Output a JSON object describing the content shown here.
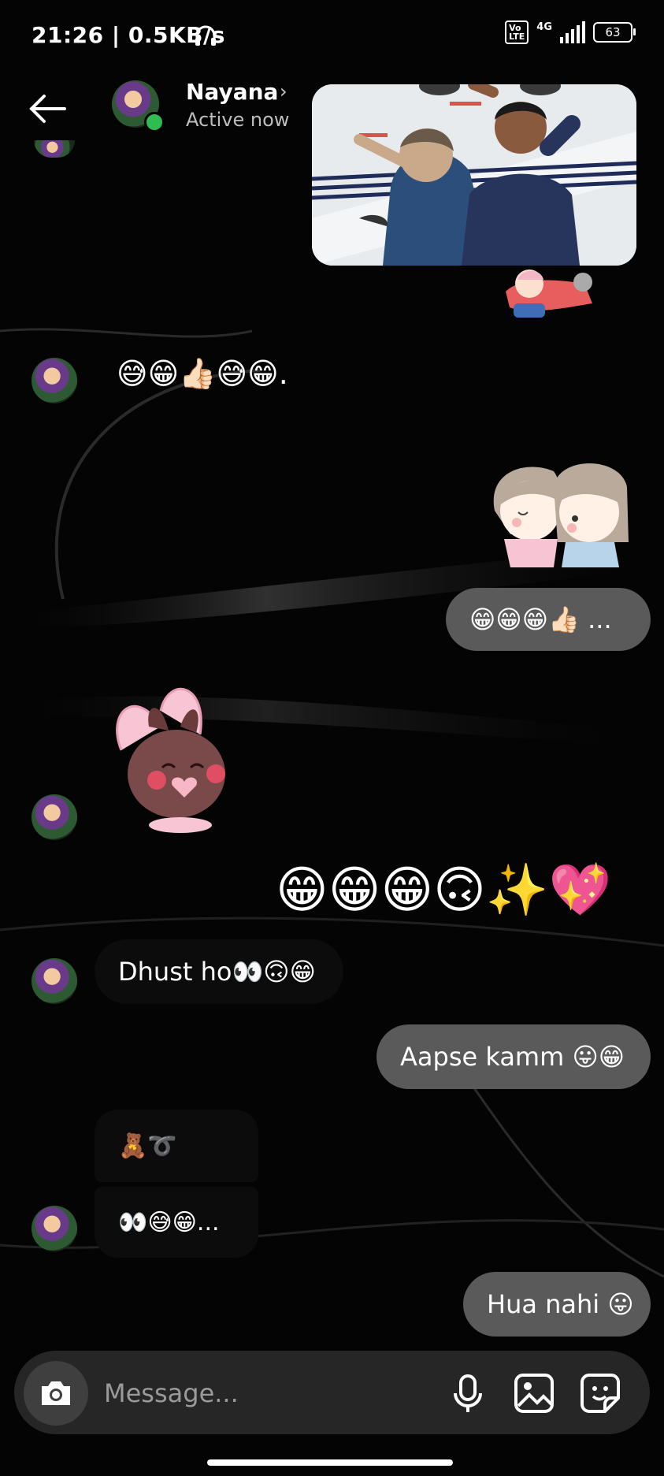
{
  "status_bar": {
    "time_speed": "21:26 | 0.5KB/s",
    "network": "4G",
    "volte": "Vo\nLTE",
    "battery": "63"
  },
  "header": {
    "name": "Nayana",
    "status": "Active now"
  },
  "messages": {
    "m1": "😅😁👍🏻😅😁.",
    "m2": "😁😁😁👍🏻 ...",
    "m3": "😁😁😁🙃✨💖",
    "m4": "Dhust ho👀🙃😁",
    "m5": "Aapse kamm 😛😁",
    "m6": "🧸➰",
    "m7": "👀😅😁...",
    "m8": "Hua nahi 😛"
  },
  "composer": {
    "placeholder": "Message..."
  },
  "colors": {
    "outgoing_bubble": "#5a5a5a",
    "incoming_bubble": "#0c0c0c",
    "online": "#2fbd52"
  }
}
